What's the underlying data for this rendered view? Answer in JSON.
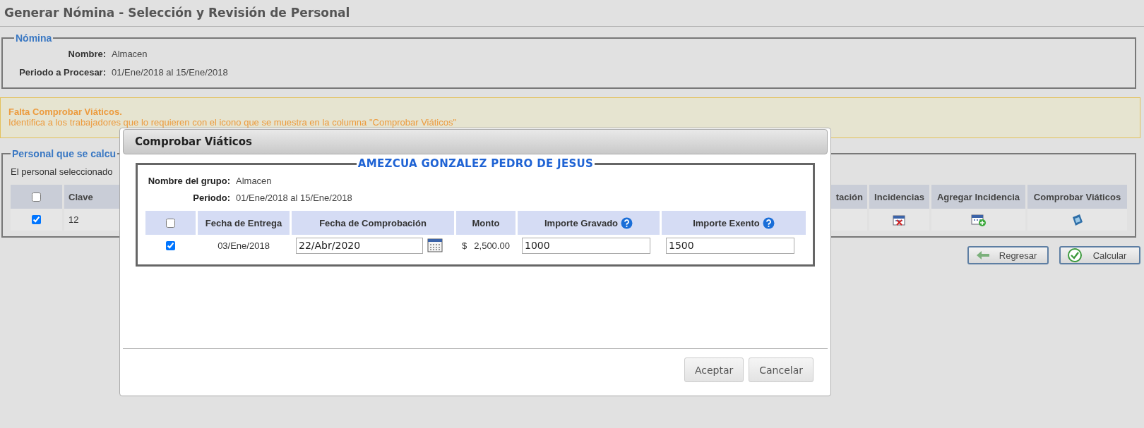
{
  "page": {
    "title": "Generar Nómina - Selección y Revisión de Personal"
  },
  "nomina": {
    "legend": "Nómina",
    "fields": [
      {
        "label": "Nombre:",
        "value": "Almacen"
      },
      {
        "label": "Periodo a Procesar:",
        "value": "01/Ene/2018 al 15/Ene/2018"
      }
    ]
  },
  "alert": {
    "title": "Falta Comprobar Viáticos.",
    "message": "Identifica a los trabajadores que lo requieren con el icono que se muestra en la columna \"Comprobar Viáticos\""
  },
  "personal": {
    "legend": "Personal que se calcu",
    "note": "El personal seleccionado",
    "header_checked": false,
    "columns": [
      {
        "label": "Clave",
        "kind": "text"
      },
      {
        "label": "tación",
        "kind": "blank"
      },
      {
        "label": "Incidencias",
        "kind": "remove-incident"
      },
      {
        "label": "Agregar Incidencia",
        "kind": "add-incident"
      },
      {
        "label": "Comprobar Viáticos",
        "kind": "expense"
      }
    ],
    "rows": [
      {
        "checked": true,
        "clave": "12"
      }
    ]
  },
  "buttons": [
    {
      "label": "Regresar",
      "kind": "back"
    },
    {
      "label": "Calcular",
      "kind": "ok"
    }
  ],
  "dialog": {
    "title": "Comprobar Viáticos",
    "legend": "AMEZCUA GONZALEZ PEDRO DE JESUS",
    "fields": [
      {
        "label": "Nombre del grupo:",
        "value": "Almacen"
      },
      {
        "label": "Periodo:",
        "value": "01/Ene/2018 al 15/Ene/2018"
      }
    ],
    "header_checked": false,
    "columns": [
      {
        "label": "Fecha de Entrega",
        "help": false
      },
      {
        "label": "Fecha de Comprobación",
        "help": false
      },
      {
        "label": "Monto",
        "help": false
      },
      {
        "label": "Importe Gravado",
        "help": true
      },
      {
        "label": "Importe Exento",
        "help": true
      }
    ],
    "rows": [
      {
        "checked": true,
        "fecha_entrega": "03/Ene/2018",
        "fecha_comprobacion": "22/Abr/2020",
        "currency": "$",
        "monto": "2,500.00",
        "importe_gravado": "1000",
        "importe_exento": "1500"
      }
    ],
    "buttons": [
      {
        "label": "Aceptar"
      },
      {
        "label": "Cancelar"
      }
    ]
  }
}
